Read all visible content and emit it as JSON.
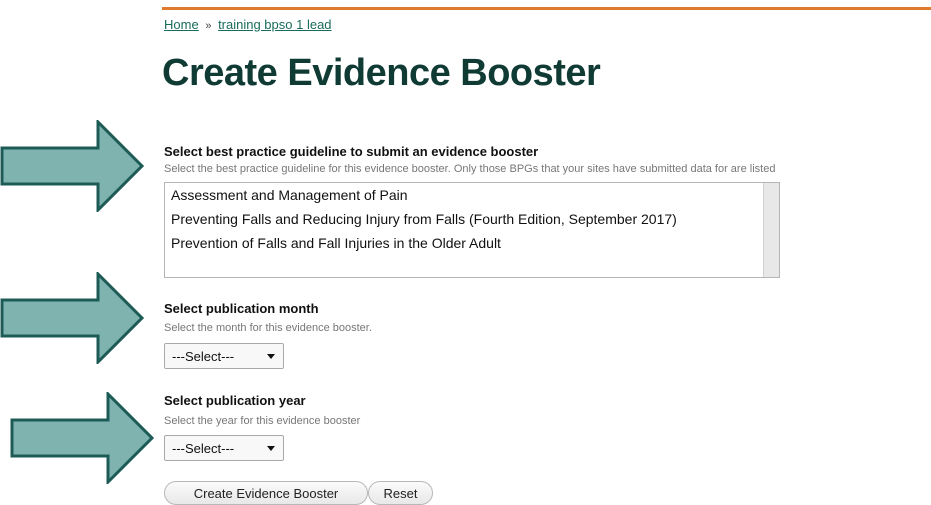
{
  "breadcrumb": {
    "home": "Home",
    "separator": "»",
    "current": "training bpso 1 lead"
  },
  "page_title": "Create Evidence Booster",
  "guideline": {
    "label": "Select best practice guideline to submit an evidence booster",
    "help": "Select the best practice guideline for this evidence booster. Only those BPGs that your sites have submitted data for are listed",
    "options": [
      "Assessment and Management of Pain",
      "Preventing Falls and Reducing Injury from Falls (Fourth Edition, September 2017)",
      "Prevention of Falls and Fall Injuries in the Older Adult"
    ]
  },
  "month": {
    "label": "Select publication month",
    "help": "Select the month for this evidence booster.",
    "selected": "---Select---"
  },
  "year": {
    "label": "Select publication year",
    "help": "Select the year for this evidence booster",
    "selected": "---Select---"
  },
  "buttons": {
    "create": "Create Evidence Booster",
    "reset": "Reset"
  },
  "colors": {
    "accent_bar": "#e07a2e",
    "title": "#0f3b34",
    "link": "#1a6b5b",
    "arrow_fill": "#7fb3b0",
    "arrow_stroke": "#1d5b57"
  }
}
